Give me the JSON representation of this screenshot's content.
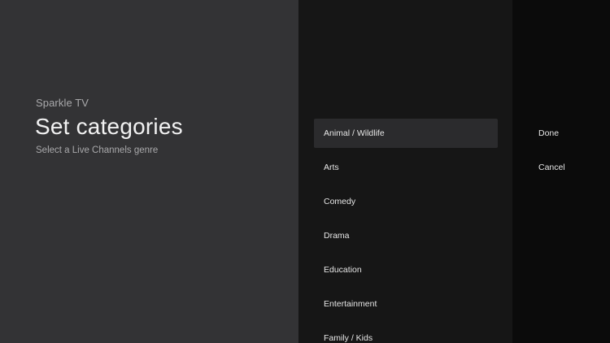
{
  "header": {
    "app_name": "Sparkle TV",
    "title": "Set categories",
    "subtitle": "Select a Live Channels genre"
  },
  "categories": {
    "selected_index": 0,
    "items": [
      {
        "label": "Animal / Wildlife"
      },
      {
        "label": "Arts"
      },
      {
        "label": "Comedy"
      },
      {
        "label": "Drama"
      },
      {
        "label": "Education"
      },
      {
        "label": "Entertainment"
      },
      {
        "label": "Family / Kids"
      }
    ]
  },
  "actions": {
    "done_label": "Done",
    "cancel_label": "Cancel"
  }
}
